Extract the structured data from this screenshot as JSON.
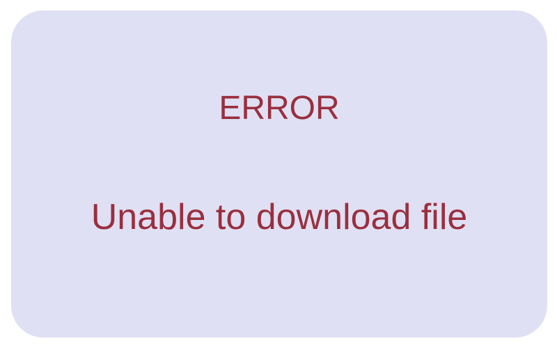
{
  "dialog": {
    "title": "ERROR",
    "message": "Unable to download file"
  },
  "colors": {
    "panel_background": "#dfe0f3",
    "text": "#9a2f3f",
    "page_background": "#ffffff"
  }
}
